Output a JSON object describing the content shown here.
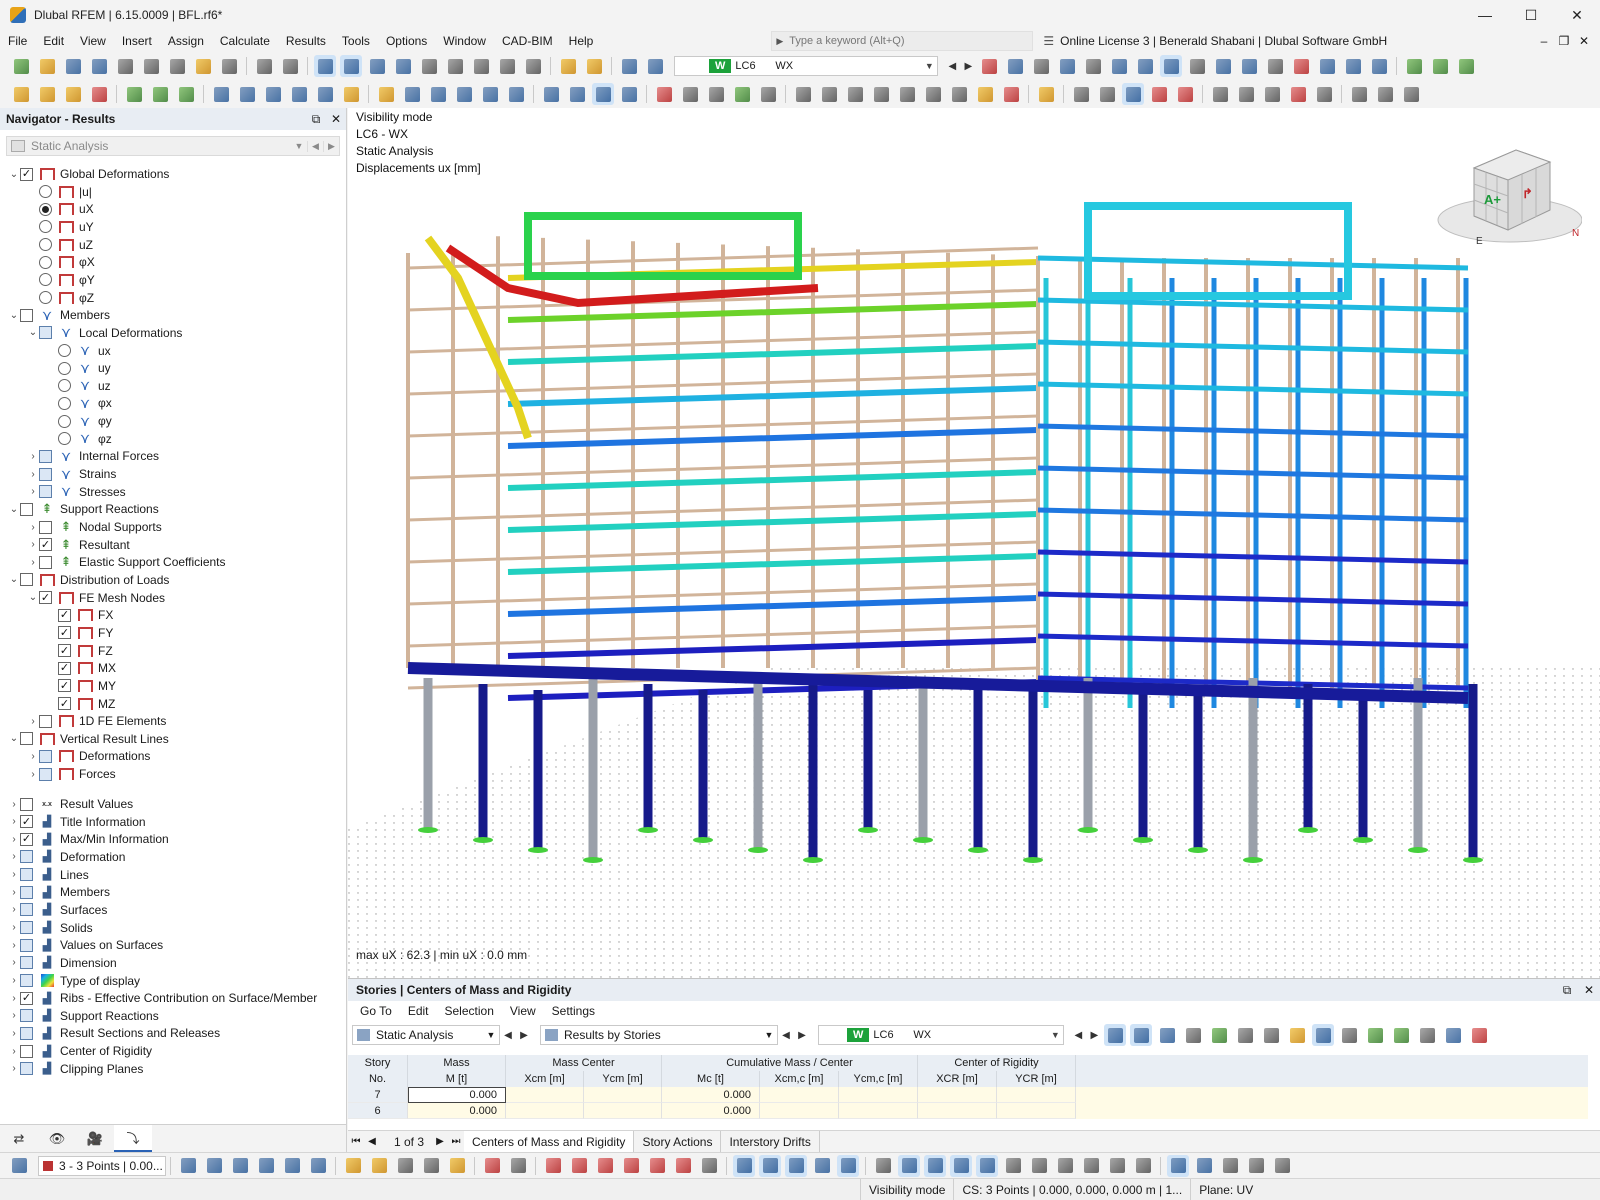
{
  "window": {
    "title": "Dlubal RFEM | 6.15.0009 | BFL.rf6*",
    "minimize": "—",
    "maximize": "☐",
    "close": "✕"
  },
  "menu": {
    "items": [
      "File",
      "Edit",
      "View",
      "Insert",
      "Assign",
      "Calculate",
      "Results",
      "Tools",
      "Options",
      "Window",
      "CAD-BIM",
      "Help"
    ],
    "search_placeholder": "Type a keyword (Alt+Q)",
    "license": "Online License 3 | Benerald Shabani | Dlubal Software GmbH"
  },
  "toolbar": {
    "lc_badge": "W",
    "lc_number": "LC6",
    "lc_name": "WX"
  },
  "navigator": {
    "title": "Navigator - Results",
    "analysis": "Static Analysis",
    "tree": [
      {
        "label": "Global Deformations",
        "level": 0,
        "exp": "⌄",
        "ctrl": "box-checked",
        "icon": "def"
      },
      {
        "label": "|u|",
        "level": 1,
        "ctrl": "radio",
        "icon": "def"
      },
      {
        "label": "uX",
        "level": 1,
        "ctrl": "radio-on",
        "icon": "def"
      },
      {
        "label": "uY",
        "level": 1,
        "ctrl": "radio",
        "icon": "def"
      },
      {
        "label": "uZ",
        "level": 1,
        "ctrl": "radio",
        "icon": "def"
      },
      {
        "label": "φX",
        "level": 1,
        "ctrl": "radio",
        "icon": "def"
      },
      {
        "label": "φY",
        "level": 1,
        "ctrl": "radio",
        "icon": "def"
      },
      {
        "label": "φZ",
        "level": 1,
        "ctrl": "radio",
        "icon": "def"
      },
      {
        "label": "Members",
        "level": 0,
        "exp": "⌄",
        "ctrl": "box",
        "icon": "mem"
      },
      {
        "label": "Local Deformations",
        "level": 1,
        "exp": "⌄",
        "ctrl": "box-partial",
        "icon": "mem"
      },
      {
        "label": "ux",
        "level": 2,
        "ctrl": "radio",
        "icon": "mem"
      },
      {
        "label": "uy",
        "level": 2,
        "ctrl": "radio",
        "icon": "mem"
      },
      {
        "label": "uz",
        "level": 2,
        "ctrl": "radio",
        "icon": "mem"
      },
      {
        "label": "φx",
        "level": 2,
        "ctrl": "radio",
        "icon": "mem"
      },
      {
        "label": "φy",
        "level": 2,
        "ctrl": "radio",
        "icon": "mem"
      },
      {
        "label": "φz",
        "level": 2,
        "ctrl": "radio",
        "icon": "mem"
      },
      {
        "label": "Internal Forces",
        "level": 1,
        "exp": "›",
        "ctrl": "box-partial",
        "icon": "mem"
      },
      {
        "label": "Strains",
        "level": 1,
        "exp": "›",
        "ctrl": "box-partial",
        "icon": "mem"
      },
      {
        "label": "Stresses",
        "level": 1,
        "exp": "›",
        "ctrl": "box-partial",
        "icon": "mem"
      },
      {
        "label": "Support Reactions",
        "level": 0,
        "exp": "⌄",
        "ctrl": "box",
        "icon": "sup"
      },
      {
        "label": "Nodal Supports",
        "level": 1,
        "exp": "›",
        "ctrl": "box",
        "icon": "sup"
      },
      {
        "label": "Resultant",
        "level": 1,
        "exp": "›",
        "ctrl": "box-checked",
        "icon": "sup"
      },
      {
        "label": "Elastic Support Coefficients",
        "level": 1,
        "exp": "›",
        "ctrl": "box",
        "icon": "sup"
      },
      {
        "label": "Distribution of Loads",
        "level": 0,
        "exp": "⌄",
        "ctrl": "box",
        "icon": "def"
      },
      {
        "label": "FE Mesh Nodes",
        "level": 1,
        "exp": "⌄",
        "ctrl": "box-checked",
        "icon": "def"
      },
      {
        "label": "FX",
        "level": 2,
        "ctrl": "box-checked",
        "icon": "def"
      },
      {
        "label": "FY",
        "level": 2,
        "ctrl": "box-checked",
        "icon": "def"
      },
      {
        "label": "FZ",
        "level": 2,
        "ctrl": "box-checked",
        "icon": "def"
      },
      {
        "label": "MX",
        "level": 2,
        "ctrl": "box-checked",
        "icon": "def"
      },
      {
        "label": "MY",
        "level": 2,
        "ctrl": "box-checked",
        "icon": "def"
      },
      {
        "label": "MZ",
        "level": 2,
        "ctrl": "box-checked",
        "icon": "def"
      },
      {
        "label": "1D FE Elements",
        "level": 1,
        "exp": "›",
        "ctrl": "box",
        "icon": "def"
      },
      {
        "label": "Vertical Result Lines",
        "level": 0,
        "exp": "⌄",
        "ctrl": "box",
        "icon": "def"
      },
      {
        "label": "Deformations",
        "level": 1,
        "exp": "›",
        "ctrl": "box-partial",
        "icon": "def"
      },
      {
        "label": "Forces",
        "level": 1,
        "exp": "›",
        "ctrl": "box-partial",
        "icon": "def"
      }
    ],
    "tree2": [
      {
        "label": "Result Values",
        "exp": "›",
        "ctrl": "box",
        "icon": "rv"
      },
      {
        "label": "Title Information",
        "exp": "›",
        "ctrl": "box-checked",
        "icon": "gen"
      },
      {
        "label": "Max/Min Information",
        "exp": "›",
        "ctrl": "box-checked",
        "icon": "gen"
      },
      {
        "label": "Deformation",
        "exp": "›",
        "ctrl": "box-partial",
        "icon": "gen"
      },
      {
        "label": "Lines",
        "exp": "›",
        "ctrl": "box-partial",
        "icon": "gen"
      },
      {
        "label": "Members",
        "exp": "›",
        "ctrl": "box-partial",
        "icon": "gen"
      },
      {
        "label": "Surfaces",
        "exp": "›",
        "ctrl": "box-partial",
        "icon": "gen"
      },
      {
        "label": "Solids",
        "exp": "›",
        "ctrl": "box-partial",
        "icon": "gen"
      },
      {
        "label": "Values on Surfaces",
        "exp": "›",
        "ctrl": "box-partial",
        "icon": "gen"
      },
      {
        "label": "Dimension",
        "exp": "›",
        "ctrl": "box-partial",
        "icon": "gen"
      },
      {
        "label": "Type of display",
        "exp": "›",
        "ctrl": "box-partial",
        "icon": "tod"
      },
      {
        "label": "Ribs - Effective Contribution on Surface/Member",
        "exp": "›",
        "ctrl": "box-checked",
        "icon": "gen"
      },
      {
        "label": "Support Reactions",
        "exp": "›",
        "ctrl": "box-partial",
        "icon": "gen"
      },
      {
        "label": "Result Sections and Releases",
        "exp": "›",
        "ctrl": "box-partial",
        "icon": "gen"
      },
      {
        "label": "Center of Rigidity",
        "exp": "›",
        "ctrl": "box",
        "icon": "gen"
      },
      {
        "label": "Clipping Planes",
        "exp": "›",
        "ctrl": "box-partial",
        "icon": "gen"
      }
    ]
  },
  "viewport": {
    "info_lines": [
      "Visibility mode",
      "LC6 - WX",
      "Static Analysis",
      "Displacements ux [mm]"
    ],
    "maxmin": "max uX : 62.3 | min uX : 0.0 mm",
    "cube_labels": {
      "front": "A+",
      "side": "E",
      "corner": "N"
    }
  },
  "table": {
    "title": "Stories | Centers of Mass and Rigidity",
    "menu": [
      "Go To",
      "Edit",
      "Selection",
      "View",
      "Settings"
    ],
    "analysis": "Static Analysis",
    "results_by": "Results by Stories",
    "lc_badge": "W",
    "lc_number": "LC6",
    "lc_name": "WX",
    "header_groups": [
      "Story No.",
      "Mass",
      "Mass Center",
      "Cumulative Mass / Center",
      "Center of Rigidity"
    ],
    "columns": [
      "No.",
      "M [t]",
      "Xcm [m]",
      "Ycm [m]",
      "Mc [t]",
      "Xcm,c [m]",
      "Ycm,c [m]",
      "XCR [m]",
      "YCR [m]"
    ],
    "rows": [
      {
        "no": "7",
        "mass": "0.000",
        "xcm": "",
        "ycm": "",
        "mc": "0.000",
        "xcmc": "",
        "ycmc": "",
        "xcr": "",
        "ycr": ""
      },
      {
        "no": "6",
        "mass": "0.000",
        "xcm": "",
        "ycm": "",
        "mc": "0.000",
        "xcmc": "",
        "ycmc": "",
        "xcr": "",
        "ycr": ""
      }
    ],
    "pager": "1 of 3",
    "tabs": [
      "Centers of Mass and Rigidity",
      "Story Actions",
      "Interstory Drifts"
    ]
  },
  "bottom": {
    "points_combo": "3 - 3 Points | 0.00..."
  },
  "status": {
    "mode": "Visibility mode",
    "cs": "CS: 3 Points | 0.000, 0.000, 0.000 m | 1...",
    "plane": "Plane: UV"
  },
  "colors": {
    "accent": "#2a62b5",
    "badge_green": "#1ca23b",
    "panel_head": "#e8edf3"
  }
}
